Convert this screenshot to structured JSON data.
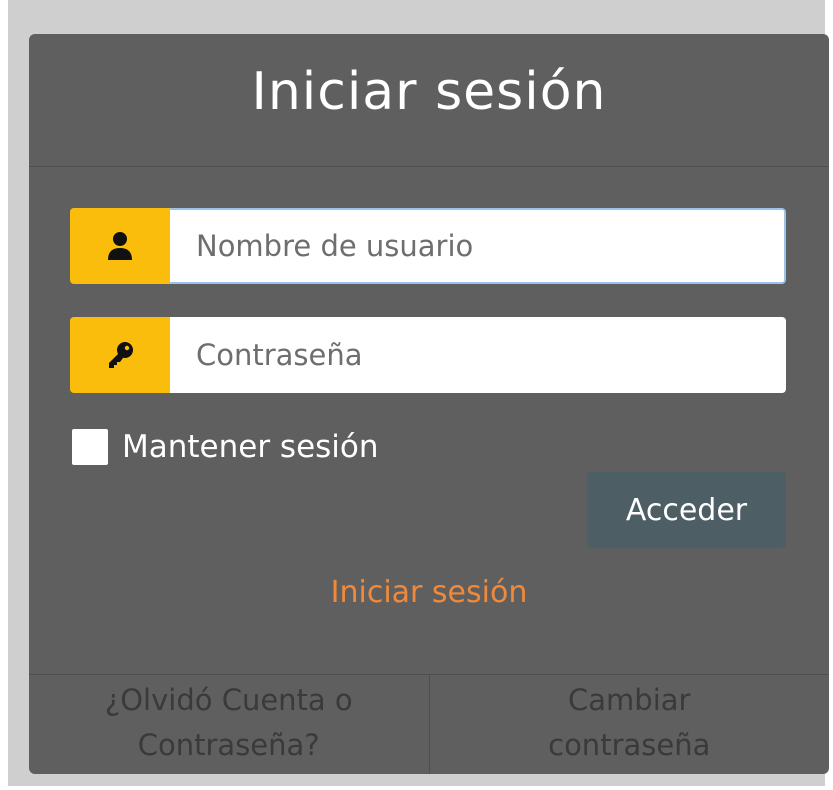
{
  "colors": {
    "page_background": "#cfcfcf",
    "card_background": "#5f5f5f",
    "icon_box": "#fbbd0c",
    "access_button": "#4d5f64",
    "link_orange": "#f08a3a",
    "footer_text": "#3a3a3a"
  },
  "login": {
    "title": "Iniciar sesión",
    "username": {
      "icon": "user-icon",
      "placeholder": "Nombre de usuario",
      "value": ""
    },
    "password": {
      "icon": "key-icon",
      "placeholder": "Contraseña",
      "value": ""
    },
    "remember": {
      "label": "Mantener sesión",
      "checked": false
    },
    "access_button": "Acceder",
    "login_link": "Iniciar sesión"
  },
  "footer": {
    "forgot": [
      "¿Olvidó Cuenta o",
      "Contraseña?"
    ],
    "change": [
      "Cambiar",
      "contraseña"
    ]
  }
}
